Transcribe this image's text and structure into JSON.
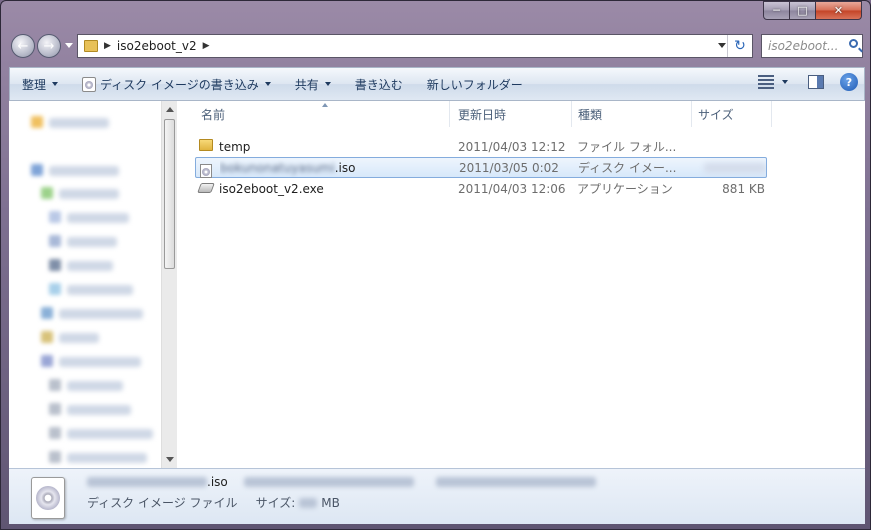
{
  "breadcrumb": {
    "folder": "iso2eboot_v2"
  },
  "search": {
    "placeholder": "iso2eboot..."
  },
  "toolbar": {
    "organize": "整理",
    "burn_disc_image": "ディスク イメージの書き込み",
    "share": "共有",
    "burn": "書き込む",
    "new_folder": "新しいフォルダー"
  },
  "columns": {
    "name": "名前",
    "date": "更新日時",
    "type": "種類",
    "size": "サイズ"
  },
  "files": [
    {
      "name": "temp",
      "date": "2011/04/03 12:12",
      "type": "ファイル フォル...",
      "size": "",
      "icon": "folder-icon"
    },
    {
      "name": ".iso",
      "date": "2011/03/05 0:02",
      "type": "ディスク イメー...",
      "size": "",
      "icon": "disc-image-icon",
      "selected": true
    },
    {
      "name": "iso2eboot_v2.exe",
      "date": "2011/04/03 12:06",
      "type": "アプリケーション",
      "size": "881 KB",
      "icon": "application-icon"
    }
  ],
  "details": {
    "filename_ext": ".iso",
    "type": "ディスク イメージ ファイル",
    "size_label": "サイズ:",
    "size_unit": "MB"
  }
}
